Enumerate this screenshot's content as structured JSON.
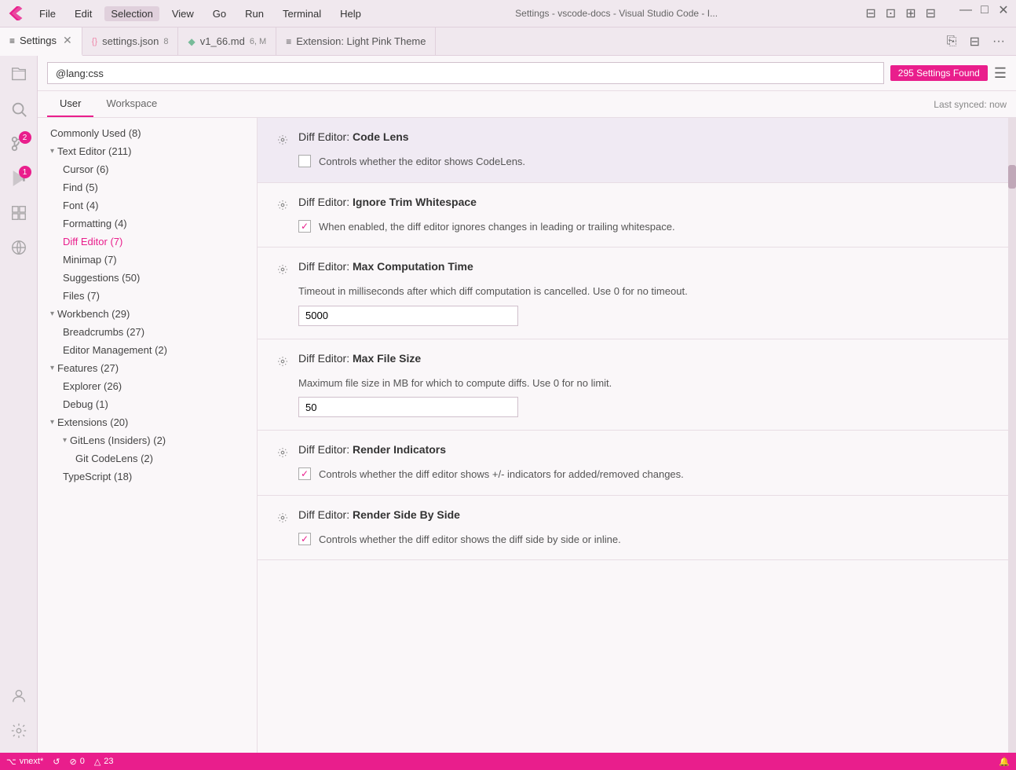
{
  "titlebar": {
    "menu_items": [
      "File",
      "Edit",
      "Selection",
      "View",
      "Go",
      "Run",
      "Terminal",
      "Help"
    ],
    "active_menu": "Selection",
    "title": "Settings - vscode-docs - Visual Studio Code - I...",
    "btn_minimize": "—",
    "btn_maximize": "□",
    "btn_close": "✕"
  },
  "tabs": [
    {
      "id": "settings",
      "label": "Settings",
      "icon": "≡",
      "active": true,
      "closable": true
    },
    {
      "id": "settings-json",
      "label": "settings.json",
      "icon": "{}",
      "badge": "8",
      "active": false,
      "closable": false
    },
    {
      "id": "v1-66",
      "label": "v1_66.md",
      "icon": "◆",
      "badge": "6, M",
      "active": false,
      "closable": false
    },
    {
      "id": "ext-theme",
      "label": "Extension: Light Pink Theme",
      "icon": "≡",
      "active": false,
      "closable": false
    }
  ],
  "tab_actions": {
    "split_editor": "⊡",
    "toggle_sidebar": "⊟",
    "more": "···"
  },
  "search": {
    "value": "@lang:css",
    "count": "295 Settings Found"
  },
  "settings_tabs": {
    "tabs": [
      "User",
      "Workspace"
    ],
    "active": "User",
    "last_synced": "Last synced: now"
  },
  "sidebar": {
    "items": [
      {
        "label": "Commonly Used (8)",
        "level": 0,
        "icon": "",
        "indent": 1
      },
      {
        "label": "Text Editor (211)",
        "level": 0,
        "icon": "▶",
        "expanded": true
      },
      {
        "label": "Cursor (6)",
        "level": 1,
        "icon": ""
      },
      {
        "label": "Find (5)",
        "level": 1,
        "icon": ""
      },
      {
        "label": "Font (4)",
        "level": 1,
        "icon": ""
      },
      {
        "label": "Formatting (4)",
        "level": 1,
        "icon": ""
      },
      {
        "label": "Diff Editor (7)",
        "level": 1,
        "icon": "",
        "active": true
      },
      {
        "label": "Minimap (7)",
        "level": 1,
        "icon": ""
      },
      {
        "label": "Suggestions (50)",
        "level": 1,
        "icon": ""
      },
      {
        "label": "Files (7)",
        "level": 1,
        "icon": ""
      },
      {
        "label": "Workbench (29)",
        "level": 0,
        "icon": "▶",
        "expanded": true
      },
      {
        "label": "Breadcrumbs (27)",
        "level": 1,
        "icon": ""
      },
      {
        "label": "Editor Management (2)",
        "level": 1,
        "icon": ""
      },
      {
        "label": "Features (27)",
        "level": 0,
        "icon": "▶",
        "expanded": true
      },
      {
        "label": "Explorer (26)",
        "level": 1,
        "icon": ""
      },
      {
        "label": "Debug (1)",
        "level": 1,
        "icon": ""
      },
      {
        "label": "Extensions (20)",
        "level": 0,
        "icon": "▶",
        "expanded": true
      },
      {
        "label": "GitLens (Insiders) (2)",
        "level": 1,
        "icon": "▶",
        "expanded": true
      },
      {
        "label": "Git CodeLens (2)",
        "level": 2,
        "icon": ""
      },
      {
        "label": "TypeScript (18)",
        "level": 1,
        "icon": ""
      }
    ]
  },
  "settings": [
    {
      "id": "code-lens",
      "title_prefix": "Diff Editor: ",
      "title_bold": "Code Lens",
      "description": "Controls whether the editor shows CodeLens.",
      "type": "checkbox",
      "checked": false,
      "highlighted": true
    },
    {
      "id": "ignore-trim",
      "title_prefix": "Diff Editor: ",
      "title_bold": "Ignore Trim Whitespace",
      "description": "When enabled, the diff editor ignores changes in leading or trailing whitespace.",
      "type": "checkbox",
      "checked": true,
      "highlighted": false
    },
    {
      "id": "max-computation-time",
      "title_prefix": "Diff Editor: ",
      "title_bold": "Max Computation Time",
      "description": "Timeout in milliseconds after which diff computation is cancelled. Use 0 for no timeout.",
      "type": "input",
      "value": "5000",
      "highlighted": false
    },
    {
      "id": "max-file-size",
      "title_prefix": "Diff Editor: ",
      "title_bold": "Max File Size",
      "description": "Maximum file size in MB for which to compute diffs. Use 0 for no limit.",
      "type": "input",
      "value": "50",
      "highlighted": false
    },
    {
      "id": "render-indicators",
      "title_prefix": "Diff Editor: ",
      "title_bold": "Render Indicators",
      "description": "Controls whether the diff editor shows +/- indicators for added/removed changes.",
      "type": "checkbox",
      "checked": true,
      "highlighted": false
    },
    {
      "id": "render-side-by-side",
      "title_prefix": "Diff Editor: ",
      "title_bold": "Render Side By Side",
      "description": "Controls whether the diff editor shows the diff side by side or inline.",
      "type": "checkbox",
      "checked": true,
      "highlighted": false
    }
  ],
  "activity_bar": {
    "items": [
      {
        "icon": "⎘",
        "name": "explorer",
        "badge": null
      },
      {
        "icon": "🔍",
        "name": "search",
        "badge": null
      },
      {
        "icon": "⌥",
        "name": "source-control",
        "badge": "2"
      },
      {
        "icon": "▷",
        "name": "run",
        "badge": "1"
      },
      {
        "icon": "⊡",
        "name": "extensions",
        "badge": null
      },
      {
        "icon": "☰",
        "name": "remote-explorer",
        "badge": null
      }
    ],
    "bottom_items": [
      {
        "icon": "◉",
        "name": "accounts"
      },
      {
        "icon": "⚙",
        "name": "settings-gear"
      }
    ]
  },
  "status_bar": {
    "left_items": [
      {
        "icon": "⌥",
        "label": "vnext*"
      },
      {
        "icon": "↺",
        "label": ""
      },
      {
        "icon": "⊘",
        "label": "0"
      },
      {
        "icon": "△",
        "label": "23"
      }
    ],
    "right_items": []
  }
}
